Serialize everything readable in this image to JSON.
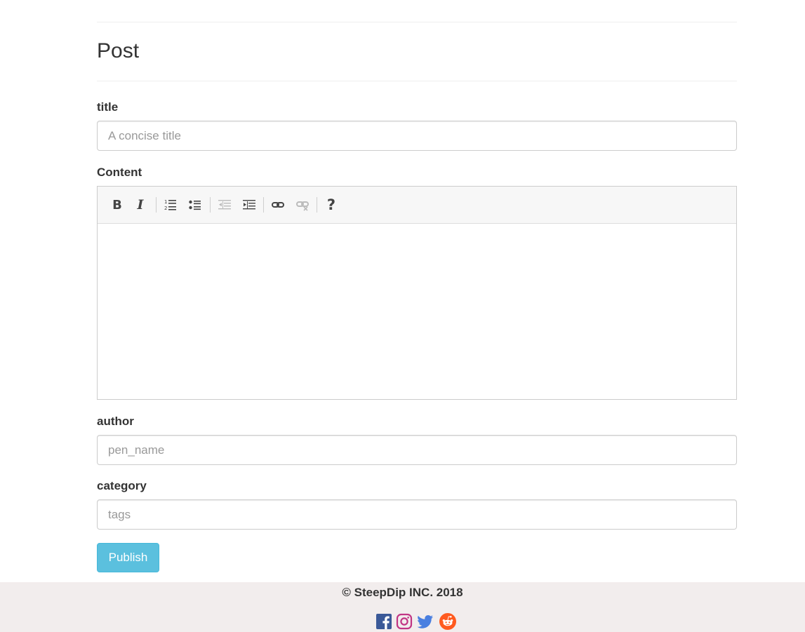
{
  "page": {
    "title": "Post"
  },
  "form": {
    "title_label": "title",
    "title_placeholder": "A concise title",
    "content_label": "Content",
    "author_label": "author",
    "author_placeholder": "pen_name",
    "category_label": "category",
    "category_placeholder": "tags",
    "publish_label": "Publish"
  },
  "editor": {
    "toolbar": [
      {
        "name": "bold",
        "icon": "bold-icon",
        "glyph": "B"
      },
      {
        "name": "italic",
        "icon": "italic-icon",
        "glyph": "I"
      },
      {
        "name": "ordered-list",
        "icon": "ordered-list-icon"
      },
      {
        "name": "unordered-list",
        "icon": "unordered-list-icon"
      },
      {
        "name": "outdent",
        "icon": "outdent-icon"
      },
      {
        "name": "indent",
        "icon": "indent-icon"
      },
      {
        "name": "link",
        "icon": "link-icon"
      },
      {
        "name": "unlink",
        "icon": "unlink-icon"
      },
      {
        "name": "help",
        "icon": "help-icon",
        "glyph": "?"
      }
    ]
  },
  "footer": {
    "copyright": "© SteepDip INC. 2018",
    "social": [
      {
        "name": "facebook-icon",
        "color": "#3b5998"
      },
      {
        "name": "instagram-icon",
        "color": "#c13584"
      },
      {
        "name": "twitter-icon",
        "color": "#1da1f2"
      },
      {
        "name": "reddit-icon",
        "color": "#ff4500"
      }
    ]
  },
  "colors": {
    "accent": "#5bc0de",
    "footer_bg": "#f2eded"
  }
}
